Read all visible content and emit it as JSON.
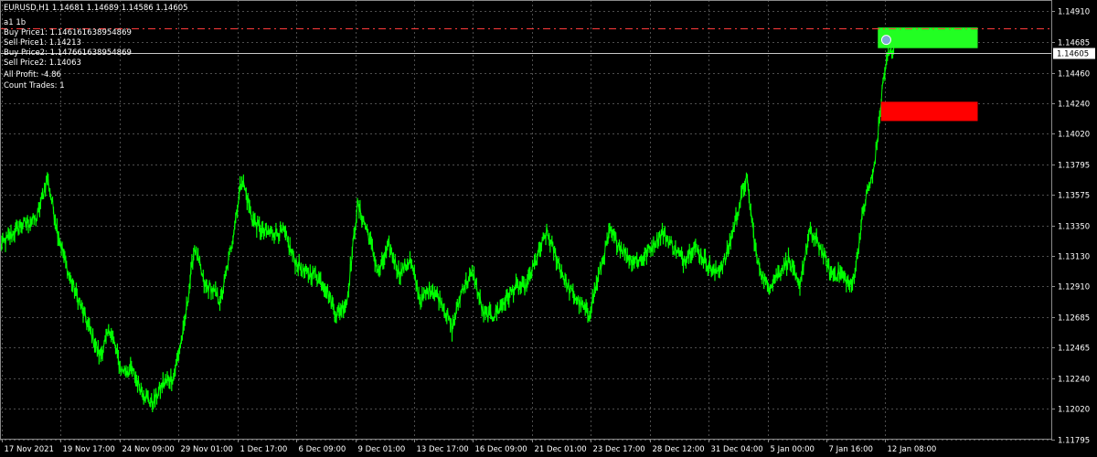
{
  "header": {
    "symbol_line": "EURUSD,H1  1.14681 1.14689 1.14586 1.14605"
  },
  "info_panel": {
    "overlap_a": "Buy Price1: 1.146161638954869",
    "overlap_b": "Sell Price1: 1.14213",
    "lines": [
      "Buy Price2: 1.147661638954869",
      "Sell Price2: 1.14063",
      "All Profit: -4.86",
      "Count Trades: 1"
    ]
  },
  "colors": {
    "background": "#000000",
    "grid": "#4D4D4D",
    "price_series": "#00FF00",
    "buy_zone": "#22FF22",
    "sell_zone": "#FF0000",
    "buy_line": "#FF3B3B",
    "bid_line": "#C8C8C8",
    "text": "#FFFFFF"
  },
  "chart_data": {
    "type": "line",
    "symbol": "EURUSD",
    "timeframe": "H1",
    "ylim": [
      1.118,
      1.1499
    ],
    "y_ticks": [
      "1.14910",
      "1.14685",
      "1.14460",
      "1.14240",
      "1.14020",
      "1.13795",
      "1.13575",
      "1.13350",
      "1.13130",
      "1.12910",
      "1.12685",
      "1.12465",
      "1.12240",
      "1.12020",
      "1.11795"
    ],
    "y_tick_values": [
      1.1491,
      1.14685,
      1.1446,
      1.1424,
      1.1402,
      1.13795,
      1.13575,
      1.1335,
      1.1313,
      1.1291,
      1.12685,
      1.12465,
      1.1224,
      1.1202,
      1.11795
    ],
    "x_ticks": [
      "17 Nov 2021",
      "19 Nov 17:00",
      "24 Nov 09:00",
      "29 Nov 01:00",
      "1 Dec 17:00",
      "6 Dec 09:00",
      "9 Dec 01:00",
      "13 Dec 17:00",
      "16 Dec 09:00",
      "21 Dec 01:00",
      "23 Dec 17:00",
      "28 Dec 12:00",
      "31 Dec 04:00",
      "5 Jan 00:00",
      "7 Jan 16:00",
      "12 Jan 08:00"
    ],
    "current_price": "1.14605",
    "current_price_value": 1.14605,
    "buy_price_line": 1.14782,
    "series": [
      {
        "x": [
          0,
          0.02,
          0.035,
          0.045,
          0.055,
          0.065,
          0.075,
          0.085,
          0.095,
          0.105,
          0.115,
          0.125,
          0.135,
          0.145,
          0.155,
          0.165,
          0.175,
          0.185,
          0.195,
          0.2,
          0.21,
          0.22,
          0.23,
          0.24,
          0.25,
          0.26,
          0.27,
          0.28,
          0.29,
          0.3,
          0.31,
          0.32,
          0.33,
          0.34,
          0.35,
          0.36,
          0.37,
          0.38,
          0.39,
          0.4,
          0.41,
          0.42,
          0.43,
          0.44,
          0.45,
          0.46,
          0.47,
          0.48,
          0.49,
          0.5,
          0.51,
          0.52,
          0.53,
          0.54,
          0.55,
          0.56,
          0.57,
          0.58,
          0.59,
          0.6,
          0.61,
          0.62,
          0.63,
          0.64,
          0.65,
          0.66,
          0.67,
          0.68,
          0.69,
          0.7,
          0.71,
          0.72,
          0.73,
          0.74,
          0.75,
          0.76,
          0.77,
          0.78,
          0.79,
          0.8,
          0.81,
          0.815,
          0.82,
          0.825,
          0.83,
          0.835,
          0.84,
          0.845,
          0.85
        ],
        "values": [
          1.132,
          1.1335,
          1.134,
          1.137,
          1.133,
          1.13,
          1.128,
          1.126,
          1.124,
          1.126,
          1.123,
          1.123,
          1.1215,
          1.1205,
          1.122,
          1.1225,
          1.126,
          1.132,
          1.129,
          1.129,
          1.128,
          1.132,
          1.137,
          1.134,
          1.133,
          1.133,
          1.133,
          1.131,
          1.13,
          1.13,
          1.129,
          1.127,
          1.128,
          1.135,
          1.133,
          1.13,
          1.132,
          1.13,
          1.131,
          1.128,
          1.129,
          1.128,
          1.126,
          1.129,
          1.13,
          1.127,
          1.127,
          1.128,
          1.129,
          1.129,
          1.131,
          1.133,
          1.131,
          1.129,
          1.128,
          1.127,
          1.13,
          1.133,
          1.132,
          1.131,
          1.131,
          1.132,
          1.133,
          1.132,
          1.131,
          1.132,
          1.131,
          1.13,
          1.131,
          1.134,
          1.137,
          1.131,
          1.129,
          1.13,
          1.131,
          1.129,
          1.133,
          1.132,
          1.13,
          1.13,
          1.129,
          1.131,
          1.134,
          1.136,
          1.137,
          1.14,
          1.144,
          1.146,
          1.1462
        ]
      }
    ],
    "zones": [
      {
        "kind": "buy",
        "x_start": 0.835,
        "x_end": 0.93,
        "y_low": 1.1464,
        "y_high": 1.1479
      },
      {
        "kind": "sell",
        "x_start": 0.838,
        "x_end": 0.93,
        "y_low": 1.1411,
        "y_high": 1.1425
      }
    ]
  }
}
